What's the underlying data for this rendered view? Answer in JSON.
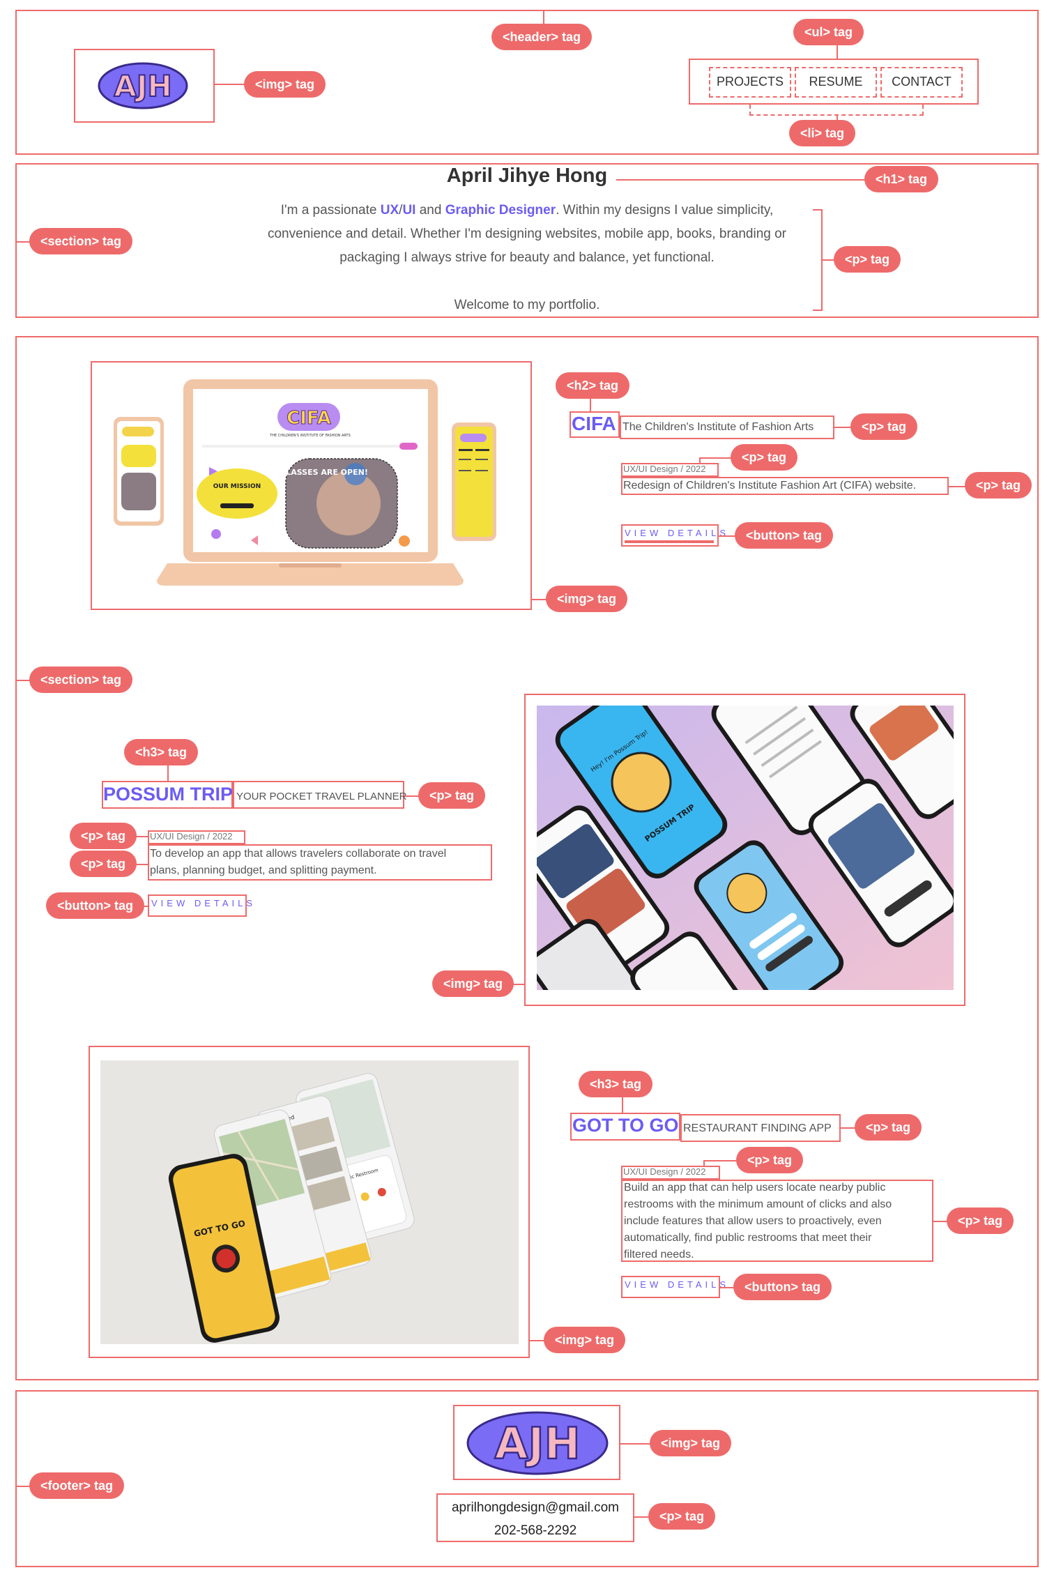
{
  "header": {
    "nav": [
      "PROJECTS",
      "RESUME",
      "CONTACT"
    ]
  },
  "hero": {
    "title": "April Jihye Hong",
    "intro_before": "I'm a passionate ",
    "intro_ux": "UX",
    "intro_slash": "/",
    "intro_ui": "UI",
    "intro_and": " and ",
    "intro_gd": "Graphic Designer",
    "intro_after": ". Within my designs I value simplicity,",
    "line2": "convenience and detail. Whether I'm designing websites, mobile app, books, branding or",
    "line3": "packaging I always strive for beauty and balance, yet functional.",
    "welcome": "Welcome to my portfolio."
  },
  "logo": {
    "text": "AJH"
  },
  "projects": [
    {
      "title": "CIFA",
      "subtitle": "The Children's Institute of Fashion Arts",
      "category": "UX/UI Design / 2022",
      "description": [
        "Redesign of Children's Institute Fashion Art (CIFA) website."
      ],
      "button": "VIEW DETAILS"
    },
    {
      "title": "POSSUM TRIP",
      "subtitle": "YOUR POCKET TRAVEL PLANNER",
      "category": "UX/UI Design / 2022",
      "description": [
        "To develop an app that allows travelers collaborate on travel",
        "plans, planning budget, and splitting payment."
      ],
      "button": "VIEW DETAILS"
    },
    {
      "title": "GOT TO GO",
      "subtitle": "RESTAURANT FINDING APP",
      "category": "UX/UI Design / 2022",
      "description": [
        "Build an app that can help users locate nearby public",
        "restrooms with the minimum amount of clicks and also",
        "include features that allow users to proactively, even",
        "automatically, find public restrooms that meet their",
        "filtered needs."
      ],
      "button": "VIEW DETAILS"
    }
  ],
  "mockups": {
    "cifa_logo": "CIFA",
    "cifa_tagline": "THE CHILDREN'S INSTITUTE OF FASHION ARTS",
    "cifa_mission": "OUR MISSION",
    "cifa_classes": "CLASSES ARE OPEN!",
    "possum_brand": "POSSUM TRIP",
    "possum_intro": "Hey! I'm Possum Trip!",
    "gtg_saved": "Saved",
    "gtg_brand": "GOT TO GO",
    "gtg_public": "Public Restroom"
  },
  "footer": {
    "email": "aprilhongdesign@gmail.com",
    "phone": "202-568-2292"
  },
  "tags": {
    "header": "<header> tag",
    "img": "<img> tag",
    "ul": "<ul> tag",
    "li": "<li> tag",
    "h1": "<h1> tag",
    "section": "<section> tag",
    "p": "<p> tag",
    "h2": "<h2> tag",
    "h3": "<h3> tag",
    "button": "<button> tag",
    "footer": "<footer> tag"
  },
  "colors": {
    "annotation": "#ee6a6a",
    "accent": "#6b5cf2",
    "logo_fill": "#7a6cf5",
    "logo_letters": "#f6b8c0"
  }
}
